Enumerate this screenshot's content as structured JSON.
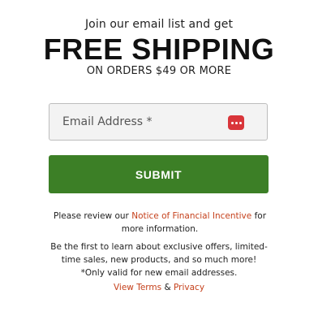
{
  "signup": {
    "pre_headline": "Join our email list and get",
    "headline": "FREE SHIPPING",
    "subhead": "ON ORDERS $49 OR MORE",
    "email_placeholder": "Email Address *",
    "email_value": "",
    "password_manager_icon": "password-manager-icon",
    "submit_label": "SUBMIT",
    "accent_color": "#3c7f26",
    "link_color": "#c5411c"
  },
  "notice": {
    "prefix": "Please review our ",
    "link_label": "Notice of Financial Incentive",
    "suffix": " for more information."
  },
  "blurb": {
    "line1": "Be the first to learn about exclusive offers, limited-time sales, new products, and so much more!",
    "line2": "*Only valid for new email addresses."
  },
  "legal": {
    "terms_label": "View Terms",
    "separator": " & ",
    "privacy_label": "Privacy"
  }
}
